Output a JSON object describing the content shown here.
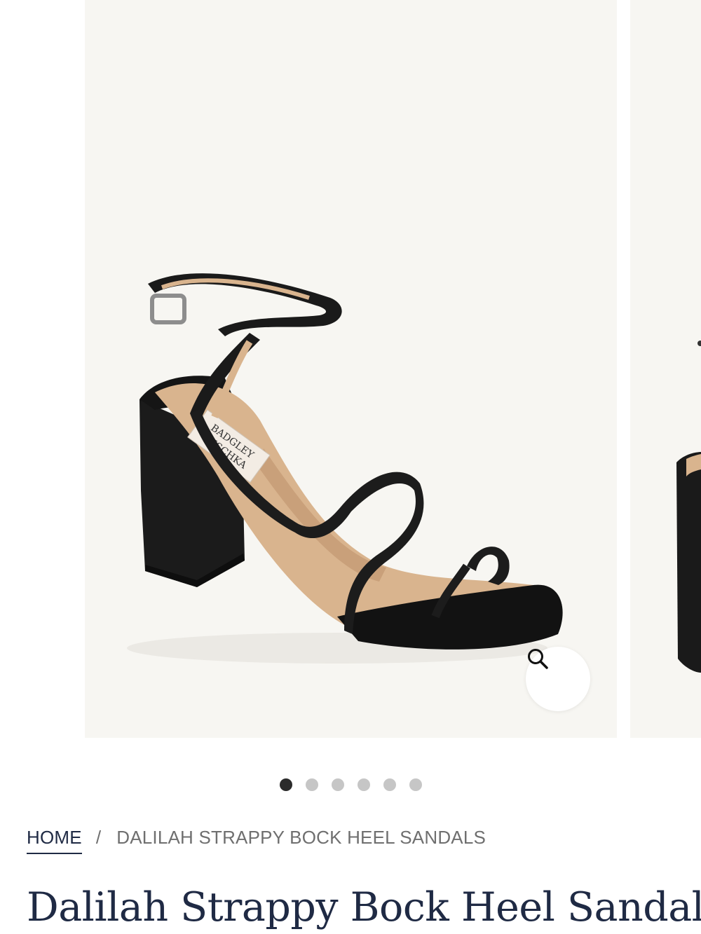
{
  "gallery": {
    "slide_count": 6,
    "active_slide": 1,
    "brand_logo": "BADGLEY MISCHKA"
  },
  "breadcrumb": {
    "home": "HOME",
    "separator": "/",
    "current": "DALILAH STRAPPY BOCK HEEL SANDALS"
  },
  "product": {
    "title": "Dalilah Strappy Bock Heel Sandals"
  },
  "icons": {
    "zoom": "magnifier-icon"
  },
  "colors": {
    "title": "#1f2a44",
    "image_bg": "#f7f6f2",
    "dot_active": "#2b2b2b",
    "dot_inactive": "#c6c6c6"
  }
}
